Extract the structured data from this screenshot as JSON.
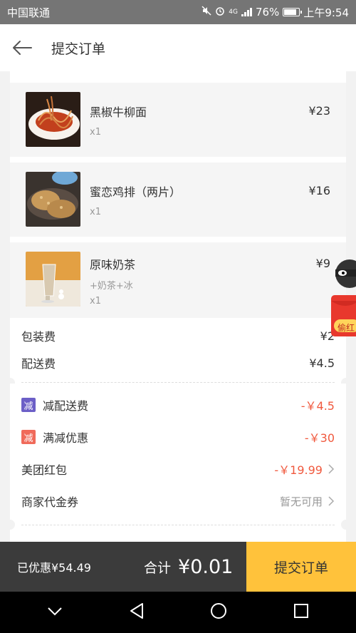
{
  "status_bar": {
    "carrier": "中国联通",
    "network": "4G",
    "battery": "76%",
    "time": "上午9:54"
  },
  "header": {
    "title": "提交订单"
  },
  "items": [
    {
      "name": "黑椒牛柳面",
      "price": "¥23",
      "qty": "x1",
      "spec": ""
    },
    {
      "name": "蜜恋鸡排（两片）",
      "price": "¥16",
      "qty": "x1",
      "spec": ""
    },
    {
      "name": "原味奶茶",
      "price": "¥9",
      "qty": "x1",
      "spec": "+奶茶+冰"
    }
  ],
  "fees": {
    "packing_label": "包装费",
    "packing_value": "¥2",
    "delivery_label": "配送费",
    "delivery_value": "¥4.5"
  },
  "discounts": {
    "delivery_discount": {
      "badge": "减",
      "label": "减配送费",
      "value": "-￥4.5",
      "badge_color": "#6c5fc7"
    },
    "full_reduction": {
      "badge": "减",
      "label": "满减优惠",
      "value": "-￥30",
      "badge_color": "#f06a5a"
    },
    "red_packet": {
      "label": "美团红包",
      "value": "-￥19.99"
    },
    "voucher": {
      "label": "商家代金券",
      "value": "暂无可用"
    }
  },
  "floating_promo": {
    "text": "偷红"
  },
  "bottom_bar": {
    "saved": "已优惠¥54.49",
    "total_label": "合计",
    "total_value": "¥0.01",
    "submit_label": "提交订单"
  },
  "colors": {
    "accent": "#ffc23b",
    "discount_red": "#f0593e",
    "bottom_bar": "#3b3b3b"
  }
}
